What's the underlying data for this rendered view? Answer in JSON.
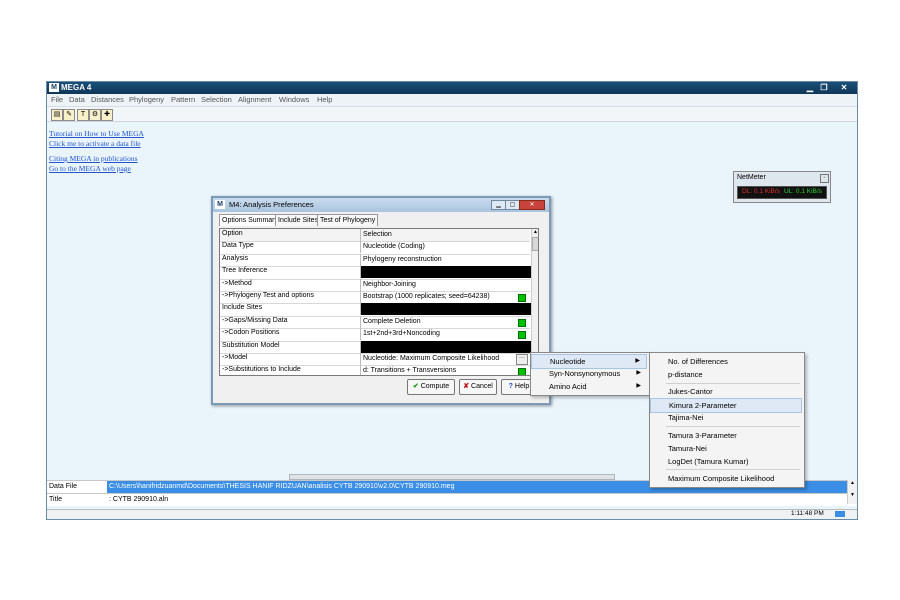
{
  "main_window": {
    "title": "MEGA 4",
    "menu": [
      "File",
      "Data",
      "Distances",
      "Phylogeny",
      "Pattern",
      "Selection",
      "Alignment",
      "Windows",
      "Help"
    ],
    "links": [
      "Tutorial on How to Use MEGA",
      "Click me to activate a data file",
      "Citing MEGA in publications",
      "Go to the MEGA web page"
    ],
    "status": {
      "data_file_label": "Data File",
      "data_file_value": "C:\\Users\\hanifridzuanmd\\Documents\\THESIS HANIF RIDZUAN\\analisis CYTB 290910\\v2.0\\CYTB 290910.meg",
      "title_label": "Title",
      "title_value": ": CYTB 290910.aln",
      "time": "1:11:48 PM"
    }
  },
  "netmeter": {
    "title": "NetMeter",
    "dl": "DL: 0.1 KiB/s",
    "ul": "UL: 0.1 KiB/s"
  },
  "dialog": {
    "title": "M4: Analysis Preferences",
    "tabs": [
      "Options Summary",
      "Include Sites",
      "Test of Phylogeny"
    ],
    "header": {
      "option": "Option",
      "selection": "Selection"
    },
    "rows": [
      {
        "option": "Data Type",
        "selection": "Nucleotide (Coding)",
        "style": "plain"
      },
      {
        "option": "Analysis",
        "selection": "Phylogeny reconstruction",
        "style": "plain"
      },
      {
        "option": "Tree Inference",
        "selection": "",
        "style": "black"
      },
      {
        "option": "->Method",
        "selection": "Neighbor-Joining",
        "style": "plain"
      },
      {
        "option": "->Phylogeny Test and options",
        "selection": "Bootstrap (1000 replicates; seed=64238)",
        "style": "green"
      },
      {
        "option": "Include Sites",
        "selection": "",
        "style": "black"
      },
      {
        "option": "->Gaps/Missing Data",
        "selection": "Complete Deletion",
        "style": "green"
      },
      {
        "option": "->Codon Positions",
        "selection": "1st+2nd+3rd+Noncoding",
        "style": "green"
      },
      {
        "option": "Substitution Model",
        "selection": "",
        "style": "black"
      },
      {
        "option": "->Model",
        "selection": "Nucleotide: Maximum Composite Likelihood",
        "style": "dots"
      },
      {
        "option": "->Substitutions to Include",
        "selection": "d: Transitions + Transversions",
        "style": "green"
      }
    ],
    "buttons": {
      "compute": "Compute",
      "cancel": "Cancel",
      "help": "Help"
    }
  },
  "submenu": {
    "items": [
      "Nucleotide",
      "Syn-Nonsynonymous",
      "Amino Acid"
    ]
  },
  "model_menu": {
    "items": [
      "No. of Differences",
      "p-distance",
      "Jukes-Cantor",
      "Kimura 2-Parameter",
      "Tajima-Nei",
      "Tamura 3-Parameter",
      "Tamura-Nei",
      "LogDet (Tamura Kumar)",
      "Maximum Composite Likelihood"
    ],
    "highlighted": "Kimura 2-Parameter"
  }
}
